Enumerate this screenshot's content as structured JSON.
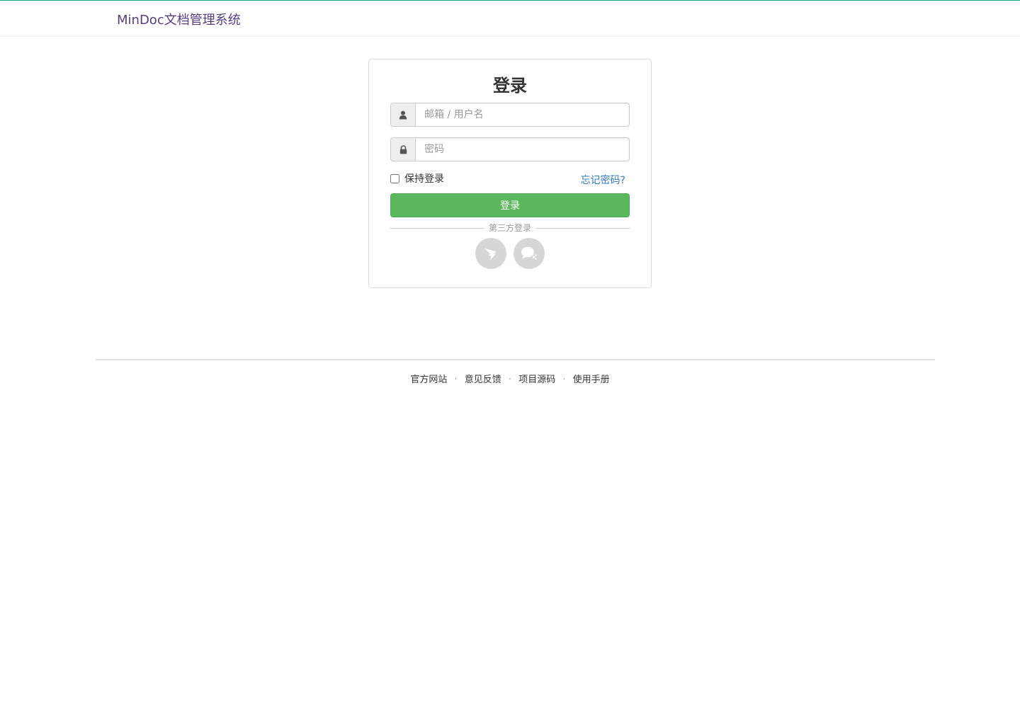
{
  "header": {
    "brand": "MinDoc文档管理系统"
  },
  "login": {
    "title": "登录",
    "username": {
      "placeholder": "邮箱 / 用户名",
      "value": "",
      "icon": "user-icon"
    },
    "password": {
      "placeholder": "密码",
      "value": "",
      "icon": "lock-icon"
    },
    "remember_label": "保持登录",
    "remember_checked": false,
    "forgot_label": "忘记密码?",
    "submit_label": "登录",
    "third_party_label": "第三方登录",
    "oauth": [
      {
        "name": "dingtalk",
        "icon": "dingtalk-icon"
      },
      {
        "name": "wechat-work",
        "icon": "wechat-work-icon"
      }
    ]
  },
  "footer": {
    "links": [
      "官方网站",
      "意见反馈",
      "项目源码",
      "使用手册"
    ],
    "separator": "·"
  },
  "colors": {
    "brand": "#563d7c",
    "accent_bar": "#1ea77f",
    "primary_button": "#5cb85c",
    "link": "#337ab7"
  }
}
